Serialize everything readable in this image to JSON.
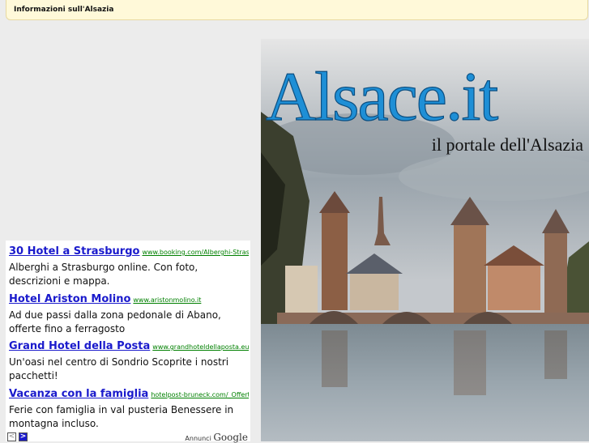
{
  "header": {
    "title": "Informazioni sull'Alsazia"
  },
  "ads": [
    {
      "title": "30 Hotel a Strasburgo",
      "url": "www.booking.com/Alberghi-Strasburgo",
      "desc": "Alberghi a Strasburgo online. Con foto, descrizioni e mappa."
    },
    {
      "title": "Hotel Ariston Molino",
      "url": "www.aristonmolino.it",
      "desc": "Ad due passi dalla zona pedonale di Abano, offerte fino a ferragosto"
    },
    {
      "title": "Grand Hotel della Posta",
      "url": "www.grandhoteldellaposta.eu",
      "desc": "Un'oasi nel centro di Sondrio Scoprite i nostri pacchetti!"
    },
    {
      "title": "Vacanza con la famiglia",
      "url": "hotelpost-bruneck.com/_Offerte",
      "desc": "Ferie con famiglia in val pusteria Benessere in montagna incluso."
    }
  ],
  "ad_footer": {
    "prev": "<",
    "next": ">",
    "label": "Annunci",
    "brand": "Google"
  },
  "banner": {
    "logo": "Alsace.it",
    "tagline": "il portale dell'Alsazia"
  },
  "colors": {
    "ad_title": "#1a1acc",
    "ad_url": "#008000",
    "header_bg": "#fff9d9",
    "logo_blue": "#1e8fd6"
  }
}
